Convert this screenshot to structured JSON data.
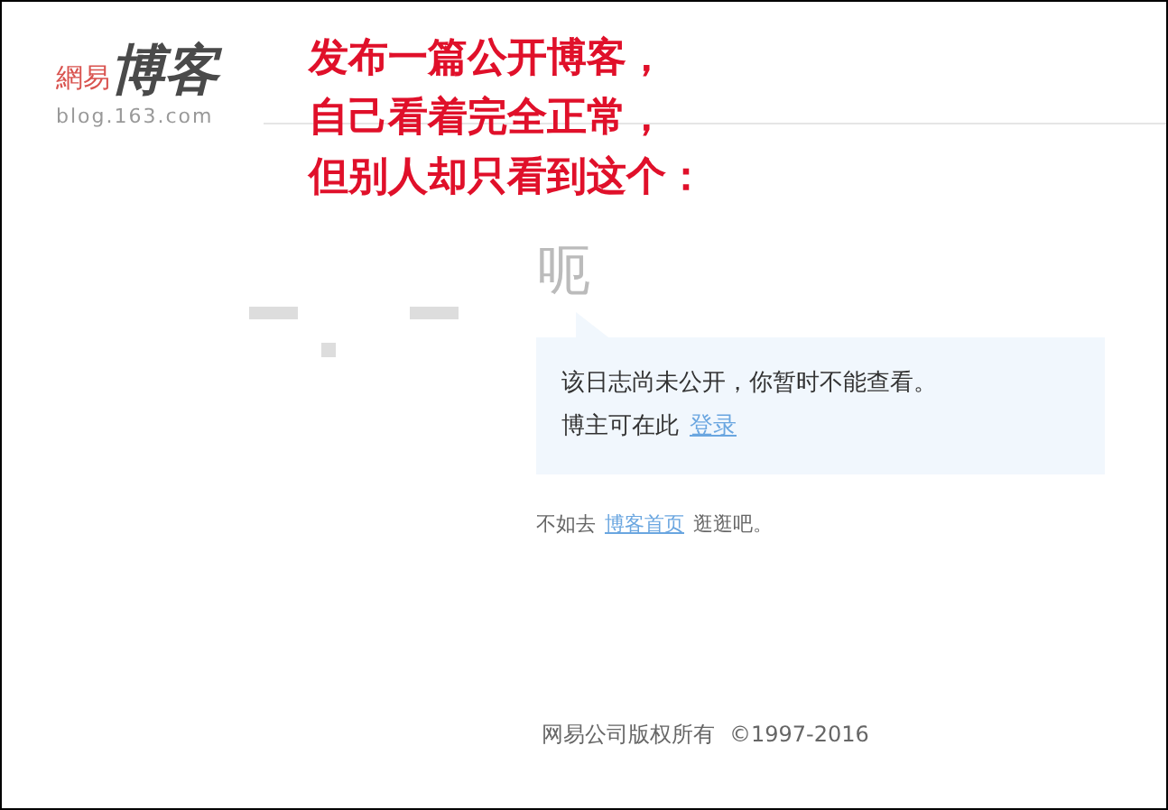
{
  "logo": {
    "name_small": "網易",
    "name_large": "博客",
    "domain": "blog.163.com"
  },
  "annotation": {
    "lines": [
      "发布一篇公开博客，",
      "自己看着完全正常，",
      "但别人却只看到这个："
    ]
  },
  "heading": "呃",
  "notice": {
    "line1": "该日志尚未公开，你暂时不能查看。",
    "line2_text": "博主可在此",
    "login_link": "登录"
  },
  "suggestion": {
    "before": "不如去",
    "link": "博客首页",
    "after": "逛逛吧。"
  },
  "footer": {
    "copyright": "网易公司版权所有",
    "years": "©1997-2016"
  }
}
